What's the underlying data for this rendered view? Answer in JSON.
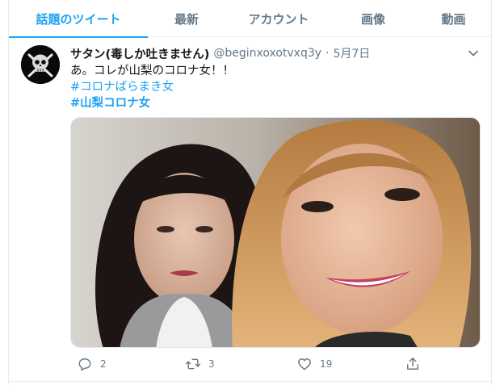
{
  "tabs": [
    {
      "label": "話題のツイート",
      "active": true
    },
    {
      "label": "最新",
      "active": false
    },
    {
      "label": "アカウント",
      "active": false
    },
    {
      "label": "画像",
      "active": false
    },
    {
      "label": "動画",
      "active": false
    }
  ],
  "tweet": {
    "display_name": "サタン(毒しか吐きません)",
    "handle": "@beginxoxotvxq3y",
    "separator": "·",
    "date": "5月7日",
    "text": "あ。コレが山梨のコロナ女！！",
    "hashtags": [
      "#コロナばらまき女",
      "#山梨コロナ女"
    ],
    "counts": {
      "replies": "2",
      "retweets": "3",
      "likes": "19"
    },
    "image_alt_icon": "photo-two-women-selfie"
  },
  "colors": {
    "accent": "#1da1f2",
    "text": "#14171a",
    "muted": "#657786",
    "border": "#e6ecf0"
  }
}
